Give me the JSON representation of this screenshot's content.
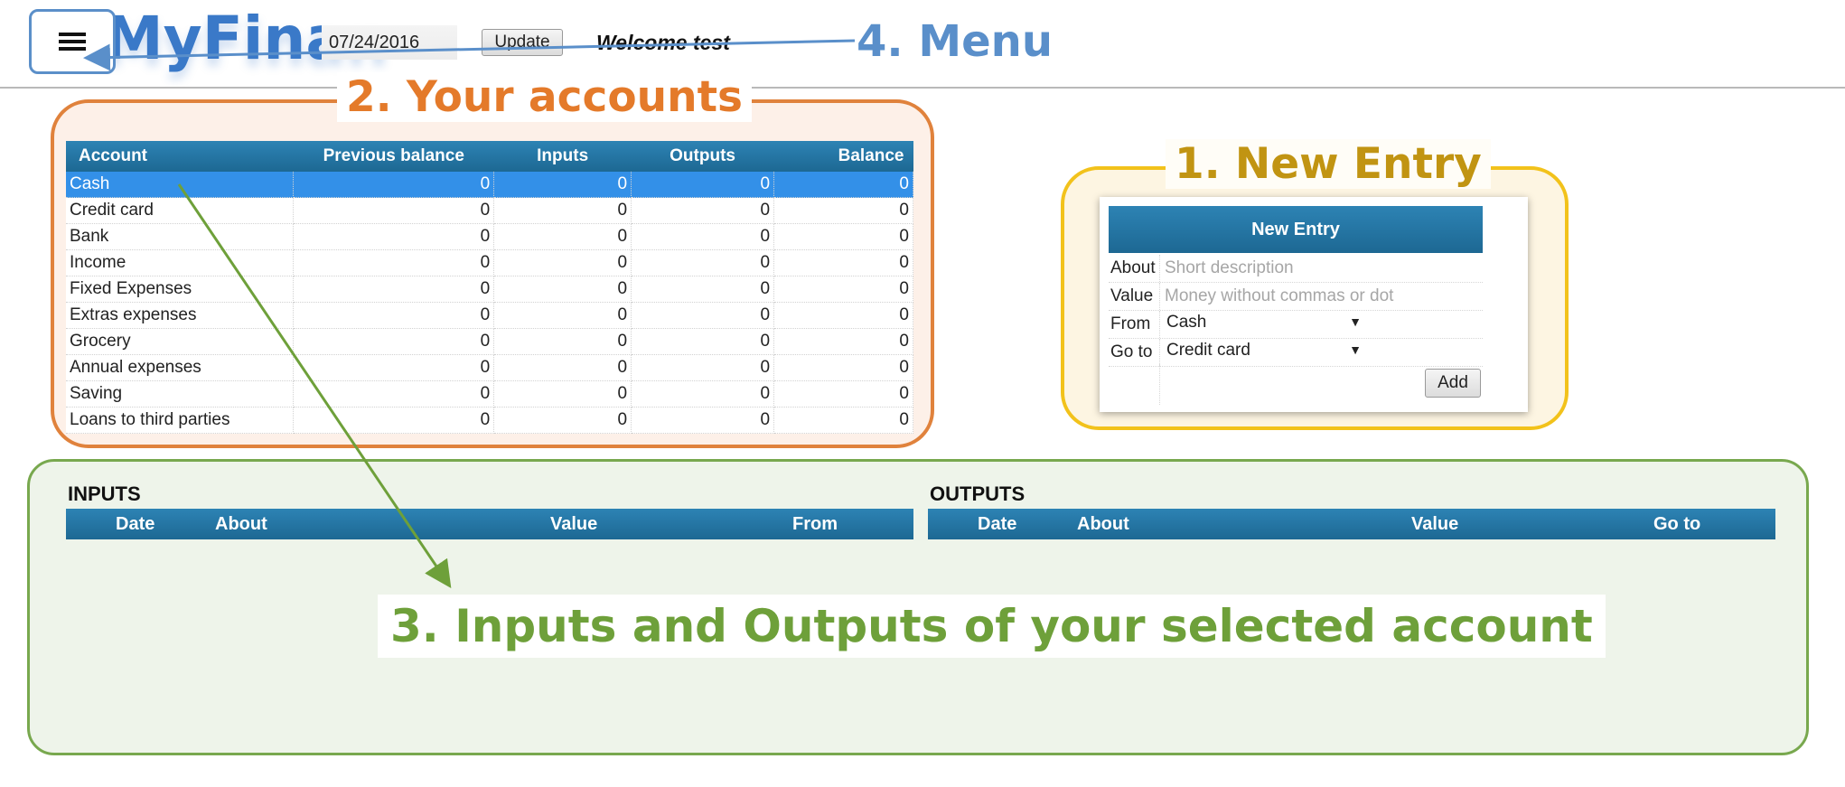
{
  "app": {
    "logo_text": "MyFinan"
  },
  "header": {
    "date_value": "07/24/2016",
    "update_label": "Update",
    "welcome_text": "Welcome test"
  },
  "callouts": {
    "new_entry": "1. New Entry",
    "accounts": "2. Your accounts",
    "inputs_outputs": "3. Inputs and Outputs of your selected account",
    "menu": "4. Menu"
  },
  "accounts": {
    "columns": [
      "Account",
      "Previous balance",
      "Inputs",
      "Outputs",
      "Balance"
    ],
    "rows": [
      {
        "name": "Cash",
        "previous": "0",
        "inputs": "0",
        "outputs": "0",
        "balance": "0"
      },
      {
        "name": "Credit card",
        "previous": "0",
        "inputs": "0",
        "outputs": "0",
        "balance": "0"
      },
      {
        "name": "Bank",
        "previous": "0",
        "inputs": "0",
        "outputs": "0",
        "balance": "0"
      },
      {
        "name": "Income",
        "previous": "0",
        "inputs": "0",
        "outputs": "0",
        "balance": "0"
      },
      {
        "name": "Fixed Expenses",
        "previous": "0",
        "inputs": "0",
        "outputs": "0",
        "balance": "0"
      },
      {
        "name": "Extras expenses",
        "previous": "0",
        "inputs": "0",
        "outputs": "0",
        "balance": "0"
      },
      {
        "name": "Grocery",
        "previous": "0",
        "inputs": "0",
        "outputs": "0",
        "balance": "0"
      },
      {
        "name": "Annual expenses",
        "previous": "0",
        "inputs": "0",
        "outputs": "0",
        "balance": "0"
      },
      {
        "name": "Saving",
        "previous": "0",
        "inputs": "0",
        "outputs": "0",
        "balance": "0"
      },
      {
        "name": "Loans to third parties",
        "previous": "0",
        "inputs": "0",
        "outputs": "0",
        "balance": "0"
      }
    ]
  },
  "new_entry": {
    "title": "New Entry",
    "about_label": "About",
    "about_placeholder": "Short description",
    "value_label": "Value",
    "value_placeholder": "Money without commas or dot",
    "from_label": "From",
    "from_value": "Cash",
    "goto_label": "Go to",
    "goto_value": "Credit card",
    "add_label": "Add"
  },
  "inputs": {
    "title": "INPUTS",
    "columns": [
      "Date",
      "About",
      "Value",
      "From"
    ]
  },
  "outputs": {
    "title": "OUTPUTS",
    "columns": [
      "Date",
      "About",
      "Value",
      "Go to"
    ]
  },
  "colors": {
    "header_blue": "#1d6893",
    "selected_row": "#3390e8",
    "accounts_frame": "#e0823c",
    "entry_frame": "#f2c21b",
    "io_frame": "#78a84e",
    "menu_callout": "#5a8fca"
  },
  "icons": {
    "menu": "hamburger-icon"
  }
}
